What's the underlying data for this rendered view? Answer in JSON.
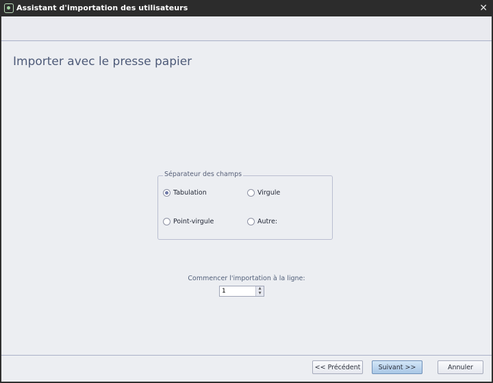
{
  "window": {
    "title": "Assistant d'importation des utilisateurs",
    "close_symbol": "✕",
    "icon": "app-icon"
  },
  "page": {
    "title": "Importer avec le presse papier"
  },
  "separator_group": {
    "title": "Séparateur des champs",
    "options": [
      {
        "label": "Tabulation",
        "checked": true
      },
      {
        "label": "Virgule",
        "checked": false
      },
      {
        "label": "Point-virgule",
        "checked": false
      },
      {
        "label": "Autre:",
        "checked": false
      }
    ]
  },
  "start_line": {
    "label": "Commencer l'importation à la ligne:",
    "value": "1"
  },
  "buttons": {
    "previous": "<< Précédent",
    "next": "Suivant >>",
    "cancel": "Annuler"
  },
  "colors": {
    "accent": "#6f7aa8",
    "primary_button": "#a9c7e6",
    "title_text": "#4d5a78"
  }
}
